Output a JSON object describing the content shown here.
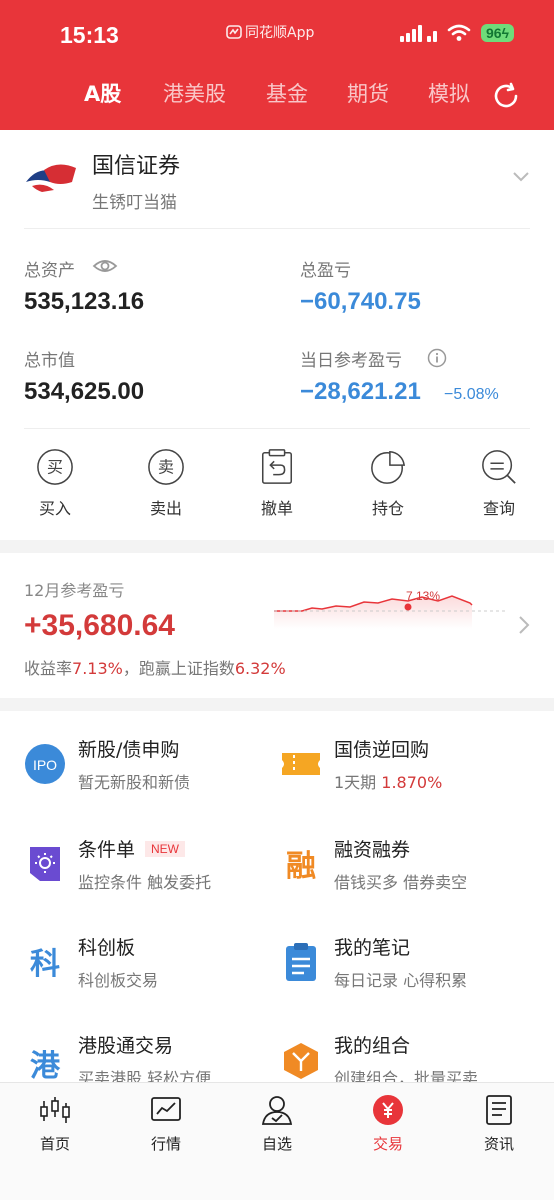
{
  "status_bar": {
    "time": "15:13",
    "app_label": "同花顺App",
    "battery": "96"
  },
  "tabs": [
    {
      "label": "A股",
      "active": true
    },
    {
      "label": "港美股",
      "active": false
    },
    {
      "label": "基金",
      "active": false
    },
    {
      "label": "期货",
      "active": false
    },
    {
      "label": "模拟",
      "active": false
    }
  ],
  "account": {
    "broker": "国信证券",
    "user": "生锈叮当猫",
    "total_assets_label": "总资产",
    "total_assets": "535,123.16",
    "total_pl_label": "总盈亏",
    "total_pl": "−60,740.75",
    "market_value_label": "总市值",
    "market_value": "534,625.00",
    "daily_pl_label": "当日参考盈亏",
    "daily_pl": "−28,621.21",
    "daily_pl_pct": "−5.08%"
  },
  "actions": [
    {
      "label": "买入",
      "glyph": "买"
    },
    {
      "label": "卖出",
      "glyph": "卖"
    },
    {
      "label": "撤单"
    },
    {
      "label": "持仓"
    },
    {
      "label": "查询"
    }
  ],
  "monthly": {
    "title": "12月参考盈亏",
    "value": "+35,680.64",
    "yield_prefix": "收益率",
    "yield": "7.13%",
    "mid": "，跑赢上证指数",
    "index_pct": "6.32%",
    "spark_label": "7.13%"
  },
  "features": [
    {
      "title": "新股/债申购",
      "sub": "暂无新股和新债",
      "icon": "ipo-icon",
      "icon_text": "IPO"
    },
    {
      "title": "国债逆回购",
      "sub_prefix": "1天期",
      "sub_value": "1.870%",
      "icon": "ticket-icon"
    },
    {
      "title": "条件单",
      "badge": "NEW",
      "sub": "监控条件 触发委托",
      "icon": "condition-icon"
    },
    {
      "title": "融资融券",
      "sub": "借钱买多 借券卖空",
      "icon": "margin-icon",
      "icon_text": "融"
    },
    {
      "title": "科创板",
      "sub": "科创板交易",
      "icon": "star-board-icon",
      "icon_text": "科"
    },
    {
      "title": "我的笔记",
      "sub": "每日记录 心得积累",
      "icon": "notes-icon"
    },
    {
      "title": "港股通交易",
      "sub": "买卖港股 轻松方便",
      "icon": "hk-connect-icon",
      "icon_text": "港"
    },
    {
      "title": "我的组合",
      "sub": "创建组合，批量买卖",
      "icon": "portfolio-icon"
    }
  ],
  "bottom_nav": [
    {
      "label": "首页",
      "active": false
    },
    {
      "label": "行情",
      "active": false
    },
    {
      "label": "自选",
      "active": false
    },
    {
      "label": "交易",
      "active": true
    },
    {
      "label": "资讯",
      "active": false
    }
  ],
  "colors": {
    "brand_red": "#e8353a",
    "loss_blue": "#3b8ad9",
    "gain_red": "#d33a3a"
  }
}
